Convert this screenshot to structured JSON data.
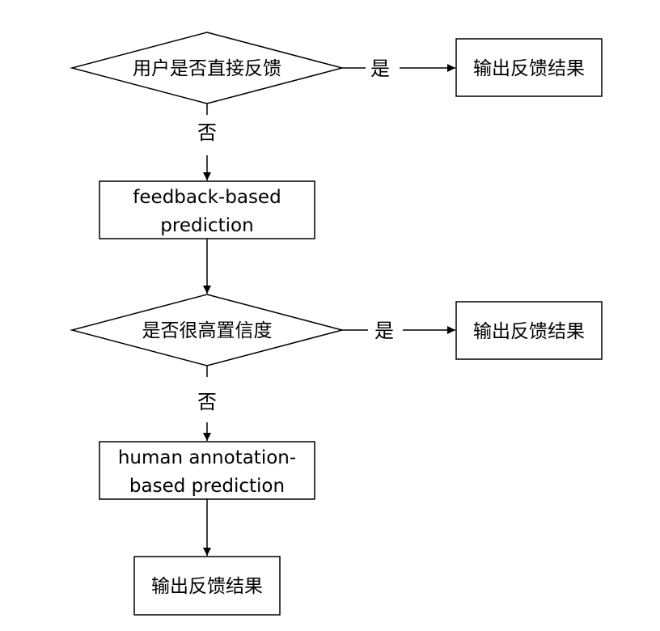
{
  "flowchart": {
    "decision1": {
      "label": "用户是否直接反馈"
    },
    "decision1_yes": {
      "label": "是"
    },
    "decision1_no": {
      "label": "否"
    },
    "output1": {
      "label": "输出反馈结果"
    },
    "process1": {
      "lines": [
        "feedback-based",
        "prediction"
      ]
    },
    "decision2": {
      "label": "是否很高置信度"
    },
    "decision2_yes": {
      "label": "是"
    },
    "decision2_no": {
      "label": "否"
    },
    "output2": {
      "label": "输出反馈结果"
    },
    "process2": {
      "lines": [
        "human annotation-",
        "based prediction"
      ]
    },
    "output3": {
      "label": "输出反馈结果"
    }
  }
}
